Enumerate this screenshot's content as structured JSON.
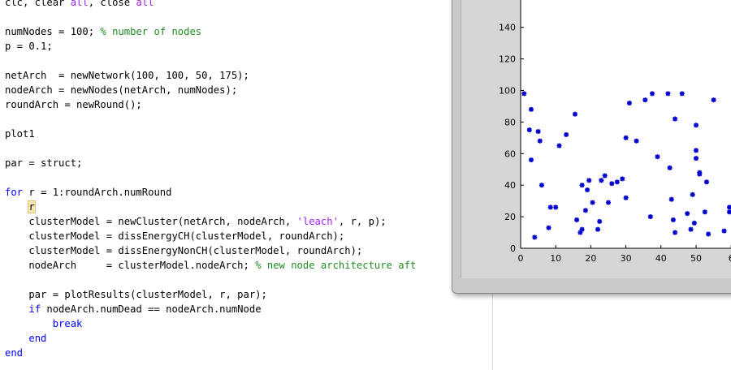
{
  "editor": {
    "lines": [
      [
        {
          "t": "clc, clear "
        },
        {
          "t": "all",
          "c": "str"
        },
        {
          "t": ", close "
        },
        {
          "t": "all",
          "c": "str"
        }
      ],
      [],
      [
        {
          "t": "numNodes = 100; "
        },
        {
          "t": "% number of nodes",
          "c": "cm"
        }
      ],
      [
        {
          "t": "p = 0.1;"
        }
      ],
      [],
      [
        {
          "t": "netArch  = newNetwork(100, 100, 50, 175);"
        }
      ],
      [
        {
          "t": "nodeArch = newNodes(netArch, numNodes);"
        }
      ],
      [
        {
          "t": "roundArch = newRound();"
        }
      ],
      [],
      [
        {
          "t": "plot1"
        }
      ],
      [],
      [
        {
          "t": "par = struct;"
        }
      ],
      [],
      [
        {
          "t": "for",
          "c": "kw"
        },
        {
          "t": " r = 1:roundArch.numRound"
        }
      ],
      [
        {
          "t": "    "
        },
        {
          "t": "r",
          "c": "cursor-var"
        }
      ],
      [
        {
          "t": "    clusterModel = newCluster(netArch, nodeArch, "
        },
        {
          "t": "'leach'",
          "c": "str"
        },
        {
          "t": ", r, p);"
        }
      ],
      [
        {
          "t": "    clusterModel = dissEnergyCH(clusterModel, roundArch);"
        }
      ],
      [
        {
          "t": "    clusterModel = dissEnergyNonCH(clusterModel, roundArch);"
        }
      ],
      [
        {
          "t": "    nodeArch     = clusterModel.nodeArch; "
        },
        {
          "t": "% new node architecture aft",
          "c": "cm"
        }
      ],
      [],
      [
        {
          "t": "    par = plotResults(clusterModel, r, par);"
        }
      ],
      [
        {
          "t": "    "
        },
        {
          "t": "if",
          "c": "kw"
        },
        {
          "t": " nodeArch.numDead == nodeArch.numNode"
        }
      ],
      [
        {
          "t": "        "
        },
        {
          "t": "break",
          "c": "kw"
        }
      ],
      [
        {
          "t": "    "
        },
        {
          "t": "end",
          "c": "kw"
        }
      ],
      [
        {
          "t": "end",
          "c": "kw"
        }
      ]
    ]
  },
  "colors": {
    "keyword": "#0000ff",
    "string": "#a020f0",
    "comment": "#228b22",
    "marker": "#0000cc"
  },
  "chart_data": {
    "type": "scatter",
    "title": "",
    "xlabel": "",
    "ylabel": "",
    "xlim": [
      0,
      60
    ],
    "ylim": [
      0,
      160
    ],
    "x_ticks": [
      "0",
      "10",
      "20",
      "30",
      "40",
      "50",
      "6"
    ],
    "y_ticks": [
      "0",
      "20",
      "40",
      "60",
      "80",
      "100",
      "120",
      "140"
    ],
    "marker": "asterisk",
    "points": [
      [
        1,
        98
      ],
      [
        3,
        88
      ],
      [
        2.5,
        75
      ],
      [
        5,
        74
      ],
      [
        5.5,
        68
      ],
      [
        3,
        56
      ],
      [
        6,
        40
      ],
      [
        4,
        7
      ],
      [
        8,
        13
      ],
      [
        8.5,
        26
      ],
      [
        10,
        26
      ],
      [
        11,
        65
      ],
      [
        13,
        72
      ],
      [
        15.5,
        85
      ],
      [
        16,
        18
      ],
      [
        17,
        10
      ],
      [
        17.5,
        12
      ],
      [
        17.5,
        40
      ],
      [
        18.5,
        24
      ],
      [
        19,
        37
      ],
      [
        19.5,
        43
      ],
      [
        20.5,
        29
      ],
      [
        22,
        12
      ],
      [
        22.5,
        17
      ],
      [
        23,
        43
      ],
      [
        24,
        46
      ],
      [
        25,
        29
      ],
      [
        26,
        41
      ],
      [
        27.5,
        42
      ],
      [
        29,
        44
      ],
      [
        30,
        32
      ],
      [
        30,
        70
      ],
      [
        31,
        92
      ],
      [
        33,
        68
      ],
      [
        35.5,
        94
      ],
      [
        37,
        20
      ],
      [
        37.5,
        98
      ],
      [
        39,
        58
      ],
      [
        42,
        98
      ],
      [
        42.5,
        51
      ],
      [
        43,
        31
      ],
      [
        43.5,
        18
      ],
      [
        44,
        10
      ],
      [
        44,
        82
      ],
      [
        46,
        98
      ],
      [
        47.5,
        22
      ],
      [
        48.5,
        12
      ],
      [
        49.5,
        16
      ],
      [
        49,
        34
      ],
      [
        50,
        57
      ],
      [
        50,
        62
      ],
      [
        50,
        78
      ],
      [
        51,
        47
      ],
      [
        51,
        48
      ],
      [
        52.5,
        23
      ],
      [
        53.5,
        9
      ],
      [
        53,
        42
      ],
      [
        55,
        94
      ],
      [
        58,
        11
      ],
      [
        59.5,
        23
      ],
      [
        59.5,
        26
      ]
    ]
  }
}
